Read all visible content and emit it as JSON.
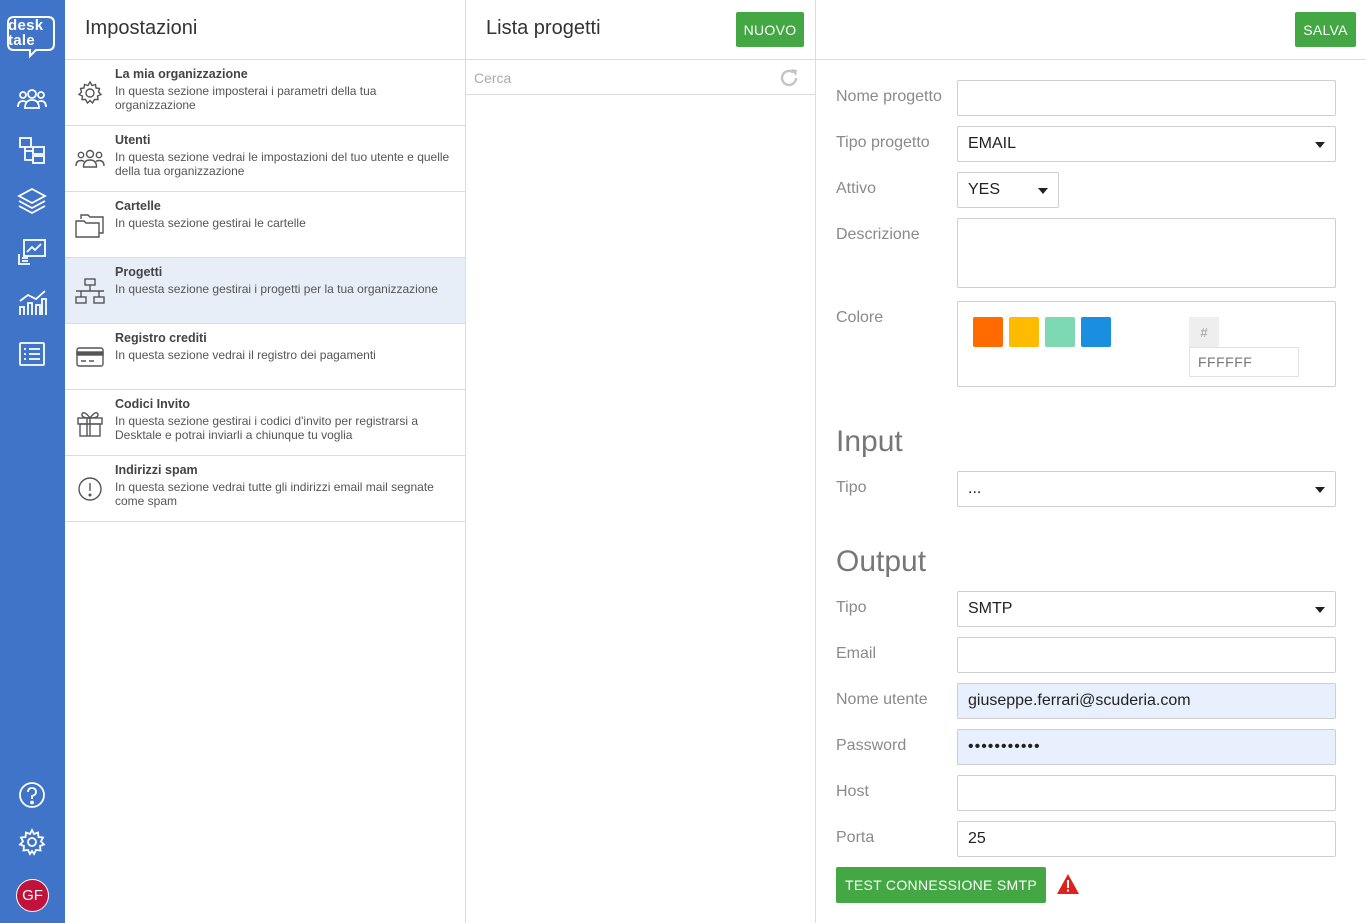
{
  "brand": {
    "logo_text_line1": "desk",
    "logo_text_line2": "tale"
  },
  "rail": {
    "items": [
      {
        "icon": "users-icon"
      },
      {
        "icon": "folders-tree-icon"
      },
      {
        "icon": "layers-icon"
      },
      {
        "icon": "chart-monitor-icon"
      },
      {
        "icon": "bar-chart-icon"
      },
      {
        "icon": "list-icon"
      }
    ],
    "bottom": [
      {
        "icon": "help-icon"
      },
      {
        "icon": "gear-icon"
      }
    ],
    "avatar_initials": "GF",
    "color": "#3f74c9"
  },
  "settings": {
    "title": "Impostazioni",
    "items": [
      {
        "title": "La mia organizzazione",
        "desc": "In questa sezione imposterai i parametri della tua organizzazione",
        "icon": "gear-icon",
        "active": false
      },
      {
        "title": "Utenti",
        "desc": "In questa sezione vedrai le impostazioni del tuo utente e quelle della tua organizzazione",
        "icon": "users-icon",
        "active": false
      },
      {
        "title": "Cartelle",
        "desc": "In questa sezione gestirai le cartelle",
        "icon": "folder-icon",
        "active": false
      },
      {
        "title": "Progetti",
        "desc": "In questa sezione gestirai i progetti per la tua organizzazione",
        "icon": "sitemap-icon",
        "active": true
      },
      {
        "title": "Registro crediti",
        "desc": "In questa sezione vedrai il registro dei pagamenti",
        "icon": "credit-card-icon",
        "active": false
      },
      {
        "title": "Codici Invito",
        "desc": "In questa sezione gestirai i codici d'invito per registrarsi a Desktale e potrai inviarli a chiunque tu voglia",
        "icon": "gift-icon",
        "active": false
      },
      {
        "title": "Indirizzi spam",
        "desc": "In questa sezione vedrai tutte gli indirizzi email mail segnate come spam",
        "icon": "alert-circle-icon",
        "active": false
      }
    ]
  },
  "projects": {
    "title": "Lista progetti",
    "new_label": "NUOVO",
    "search_placeholder": "Cerca"
  },
  "form": {
    "save_label": "SALVA",
    "labels": {
      "name": "Nome progetto",
      "type": "Tipo progetto",
      "active": "Attivo",
      "description": "Descrizione",
      "color": "Colore",
      "input_type": "Tipo",
      "output_type": "Tipo",
      "email": "Email",
      "username": "Nome utente",
      "password": "Password",
      "host": "Host",
      "port": "Porta"
    },
    "values": {
      "name": "",
      "type": "EMAIL",
      "active": "YES",
      "description": "",
      "input_type": "...",
      "output_type": "SMTP",
      "email": "",
      "username": "giuseppe.ferrari@scuderia.com",
      "password": "•••••••••••",
      "host": "",
      "port": "25"
    },
    "color": {
      "swatches": [
        "#ff6b00",
        "#ffbb00",
        "#7dd9b3",
        "#1a8fe0"
      ],
      "hash_label": "#",
      "hex_value": "FFFFFF"
    },
    "sections": {
      "input": "Input",
      "output": "Output"
    },
    "test_button_label": "TEST CONNESSIONE SMTP",
    "accent_green": "#43a843",
    "warning_color": "#e0201b"
  }
}
